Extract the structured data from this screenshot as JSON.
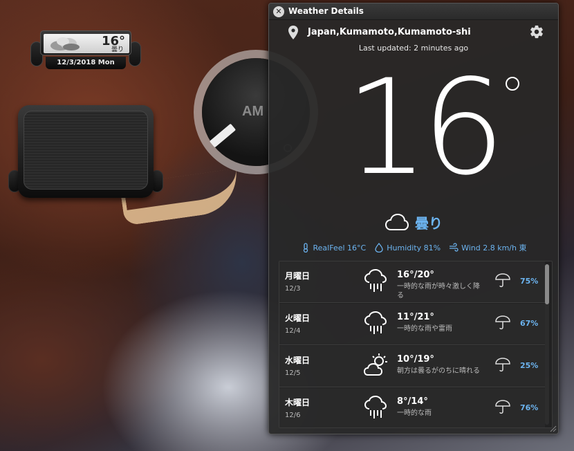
{
  "desktop": {
    "mini_widget": {
      "temp": "16°",
      "condition": "曇り",
      "date": "12/3/2018 Mon"
    },
    "clock": {
      "ampm": "AM"
    }
  },
  "window": {
    "title": "Weather Details",
    "location": "Japan,Kumamoto,Kumamoto-shi",
    "last_updated": "Last updated: 2 minutes ago",
    "temperature": "16",
    "condition": "曇り",
    "stats": {
      "realfeel": "RealFeel 16°C",
      "humidity": "Humidity 81%",
      "wind": "Wind  2.8 km/h 東"
    },
    "forecast": [
      {
        "day": "月曜日",
        "date": "12/3",
        "temp": "16°/20°",
        "desc": "一時的な雨が時々激しく降る",
        "icon": "rain-cloud-icon",
        "pop": "75%"
      },
      {
        "day": "火曜日",
        "date": "12/4",
        "temp": "11°/21°",
        "desc": "一時的な雨や雷雨",
        "icon": "rain-cloud-icon",
        "pop": "67%"
      },
      {
        "day": "水曜日",
        "date": "12/5",
        "temp": "10°/19°",
        "desc": "朝方は曇るがのちに晴れる",
        "icon": "partly-sunny-icon",
        "pop": "25%"
      },
      {
        "day": "木曜日",
        "date": "12/6",
        "temp": "8°/14°",
        "desc": "一時的な雨",
        "icon": "rain-cloud-icon",
        "pop": "76%"
      }
    ]
  },
  "colors": {
    "accent": "#6cb4f0",
    "window_bg": "#282828"
  }
}
